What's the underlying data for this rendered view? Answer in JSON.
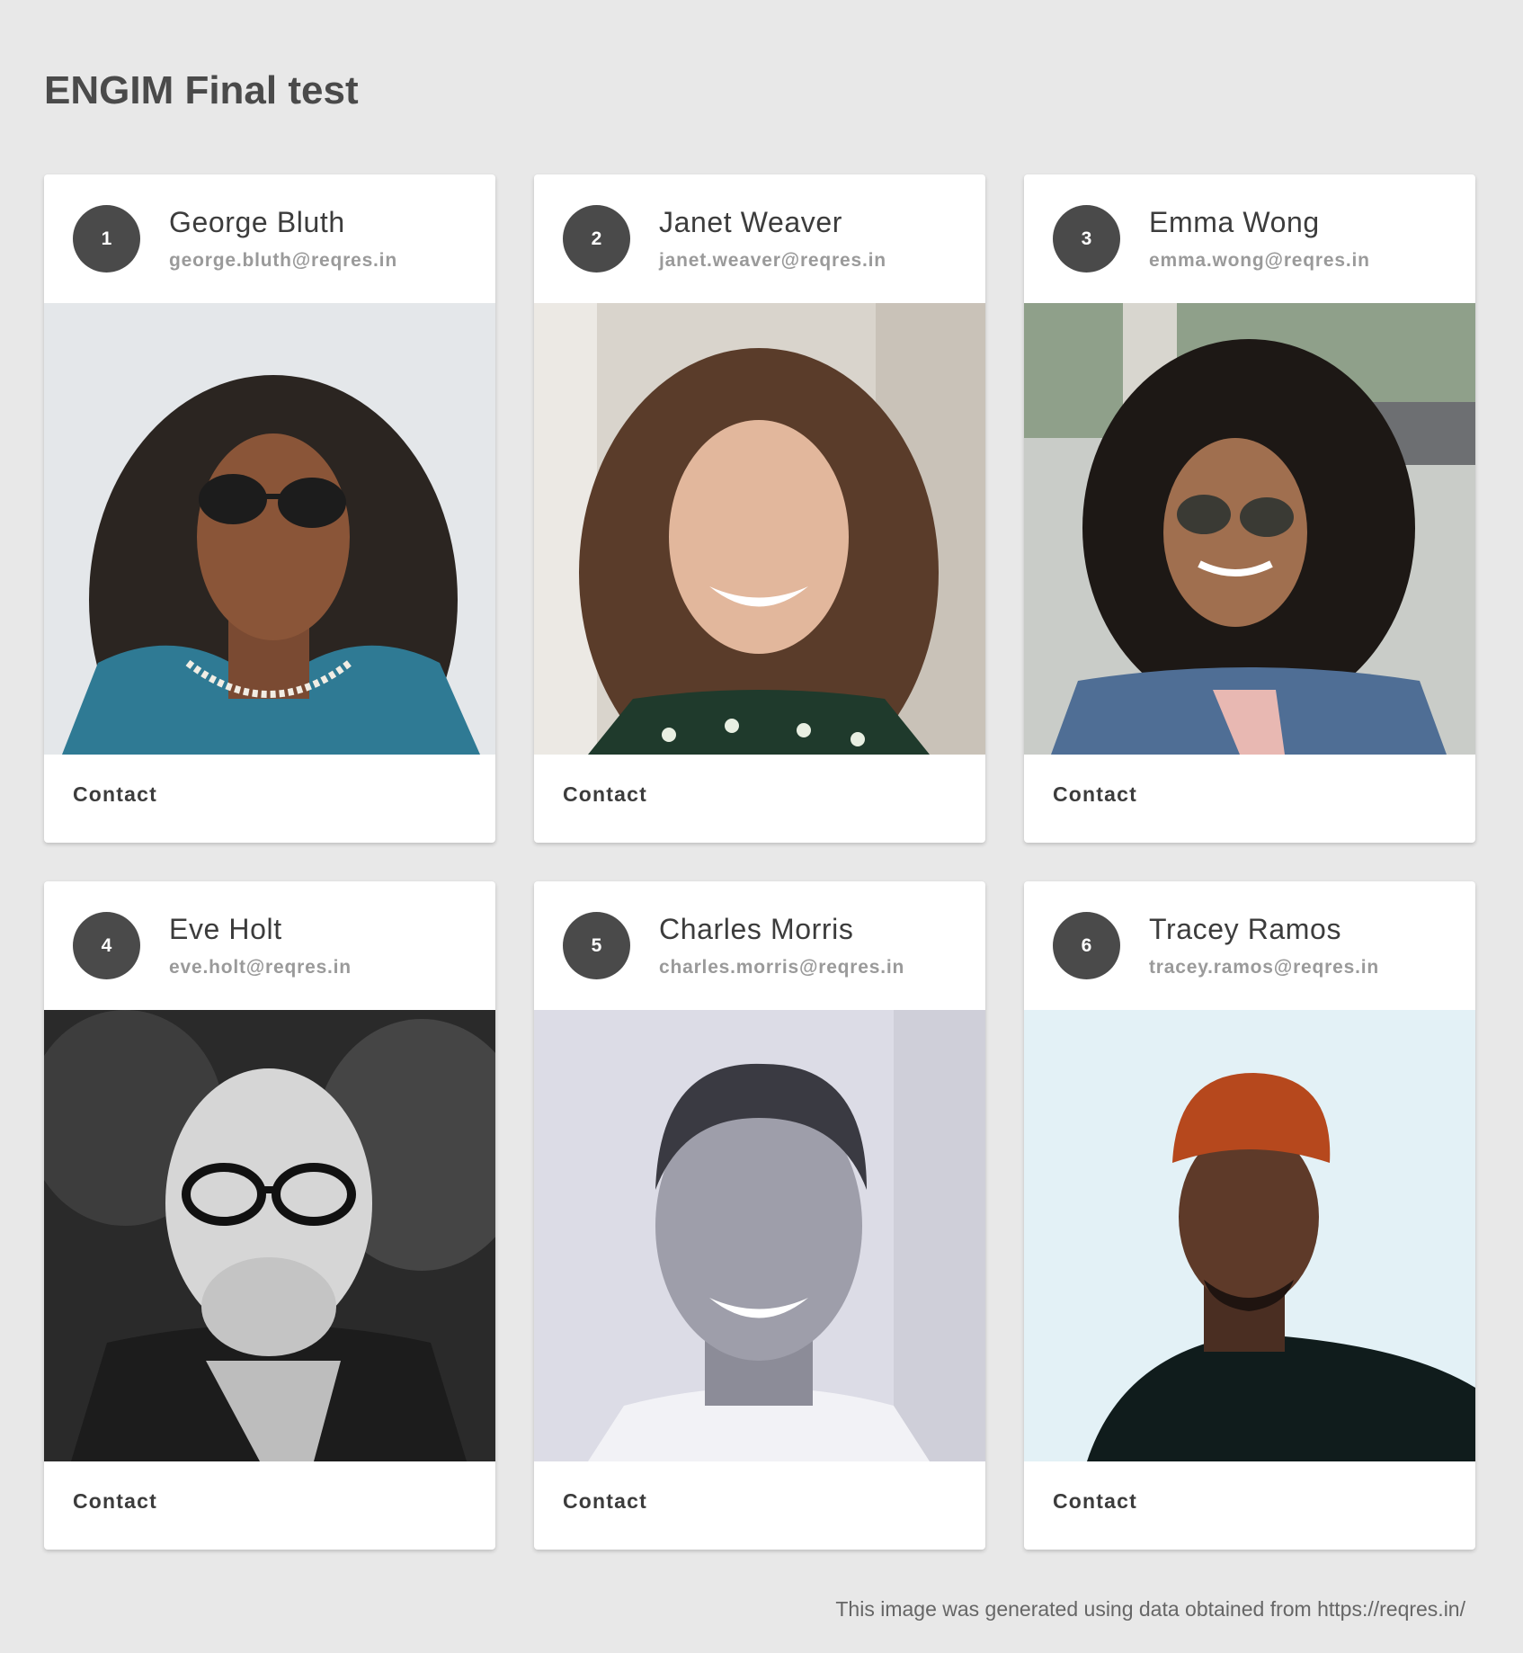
{
  "page": {
    "title": "ENGIM Final test",
    "footer": "This image was generated using data obtained from https://reqres.in/"
  },
  "cards": [
    {
      "number": "1",
      "name": "George Bluth",
      "email": "george.bluth@reqres.in",
      "action": "Contact"
    },
    {
      "number": "2",
      "name": "Janet Weaver",
      "email": "janet.weaver@reqres.in",
      "action": "Contact"
    },
    {
      "number": "3",
      "name": "Emma Wong",
      "email": "emma.wong@reqres.in",
      "action": "Contact"
    },
    {
      "number": "4",
      "name": "Eve Holt",
      "email": "eve.holt@reqres.in",
      "action": "Contact"
    },
    {
      "number": "5",
      "name": "Charles Morris",
      "email": "charles.morris@reqres.in",
      "action": "Contact"
    },
    {
      "number": "6",
      "name": "Tracey Ramos",
      "email": "tracey.ramos@reqres.in",
      "action": "Contact"
    }
  ]
}
